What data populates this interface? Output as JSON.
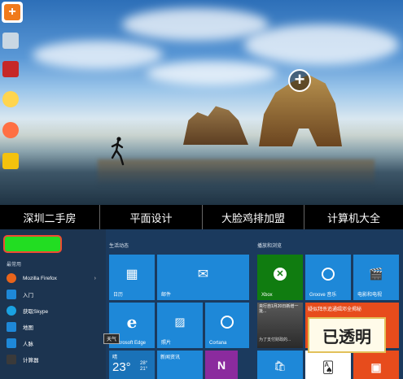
{
  "linkbar": {
    "links": [
      "深圳二手房",
      "平面设计",
      "大脸鸡排加盟",
      "计算机大全"
    ]
  },
  "start_menu": {
    "frequent_label": "最常用",
    "apps": [
      {
        "label": "Mozilla Firefox",
        "icon": "firefox-icon",
        "color": "#e8641b"
      },
      {
        "label": "入门",
        "icon": "lightbulb-icon",
        "color": "#1e88d8"
      },
      {
        "label": "获取Skype",
        "icon": "skype-icon",
        "color": "#1aa1e1"
      },
      {
        "label": "地图",
        "icon": "map-icon",
        "color": "#1e88d8"
      },
      {
        "label": "人脉",
        "icon": "people-icon",
        "color": "#1e88d8"
      },
      {
        "label": "计算器",
        "icon": "calculator-icon",
        "color": "#3a3a3a"
      }
    ],
    "group_life": "生活动态",
    "group_play": "播放和浏览",
    "tiles": {
      "calendar": "日历",
      "mail": "邮件",
      "edge": "Microsoft Edge",
      "photos": "照片",
      "cortana": "Cortana",
      "xbox": "Xbox",
      "groove": "Groove 音乐",
      "movies": "电影和电视",
      "news_headline": "央行自1月20日新增一批...",
      "news_sub": "为了支付财政的...",
      "money_headline": "疑似拜杀追通缉邓全揭秘",
      "weather_label": "晴",
      "weather_temp": "23°",
      "weather_range": "28°\n21°",
      "newsapp": "新闻资讯",
      "onenote": "N"
    },
    "tooltip": "天气",
    "badge": "已透明",
    "colors": {
      "accent_blue": "#1e88d8",
      "xbox_green": "#107c10",
      "onenote_purple": "#8b2b9e",
      "office_orange": "#e74c1c"
    }
  }
}
